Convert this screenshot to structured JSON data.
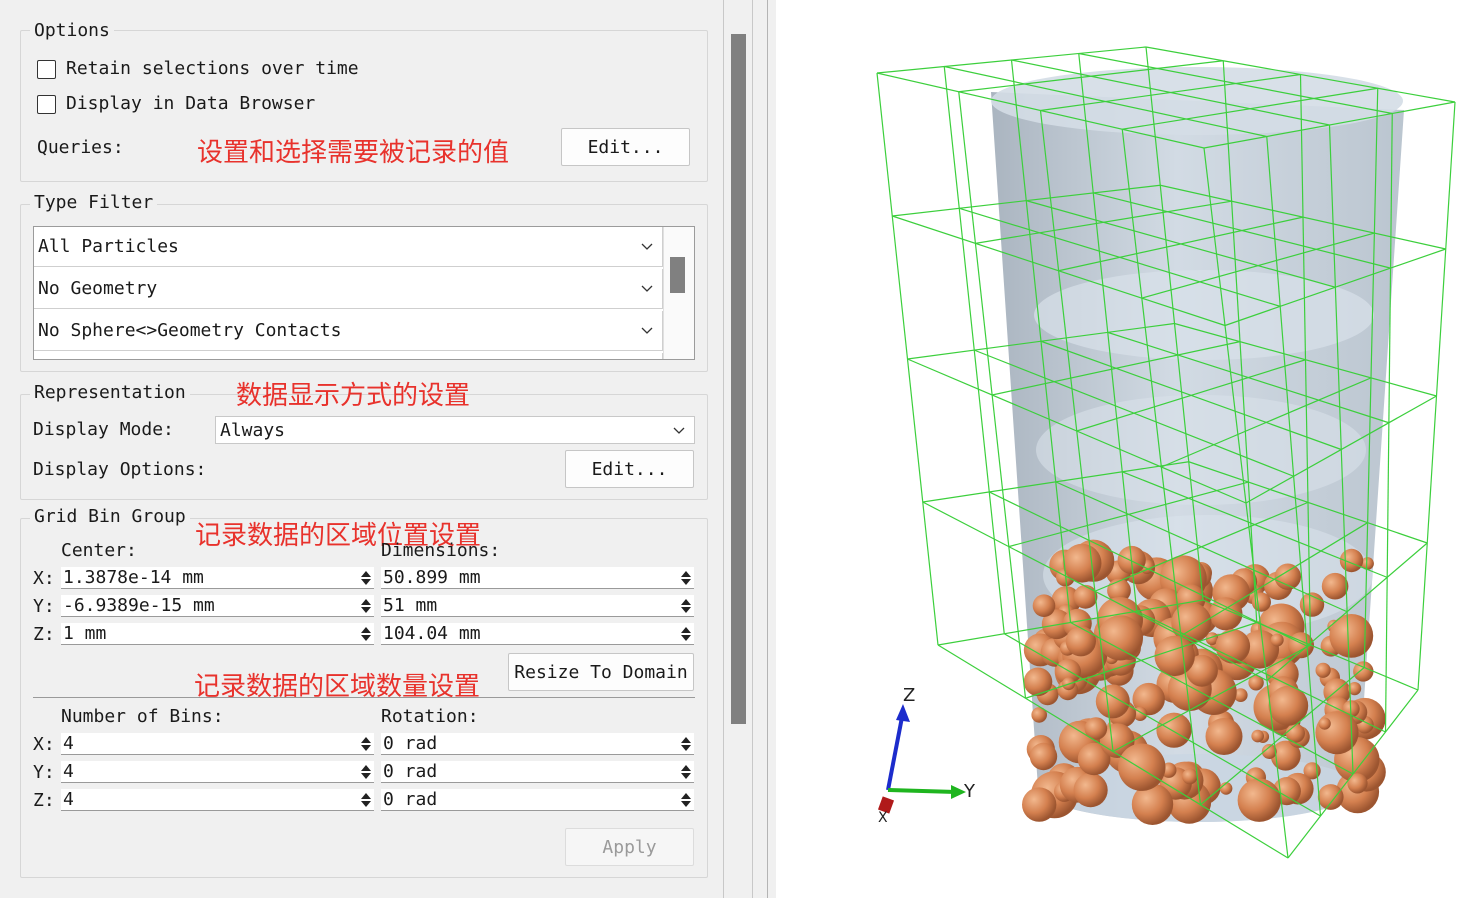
{
  "options": {
    "title": "Options",
    "retain_label": "Retain selections over time",
    "retain_checked": false,
    "display_browser_label": "Display in Data Browser",
    "display_browser_checked": false,
    "queries_label": "Queries:",
    "queries_edit": "Edit...",
    "annotation": "设置和选择需要被记录的值"
  },
  "type_filter": {
    "title": "Type Filter",
    "items": [
      "All Particles",
      "No Geometry",
      "No Sphere<>Geometry Contacts"
    ]
  },
  "representation": {
    "title": "Representation",
    "annotation": "数据显示方式的设置",
    "display_mode_label": "Display Mode:",
    "display_mode_value": "Always",
    "display_options_label": "Display Options:",
    "display_options_edit": "Edit..."
  },
  "grid_bin_group": {
    "title": "Grid Bin Group",
    "annotation_position": "记录数据的区域位置设置",
    "annotation_count": "记录数据的区域数量设置",
    "center_label": "Center:",
    "dimensions_label": "Dimensions:",
    "axes": [
      "X:",
      "Y:",
      "Z:"
    ],
    "center": [
      "1.3878e-14 mm",
      "-6.9389e-15 mm",
      "1 mm"
    ],
    "dimensions": [
      "50.899 mm",
      "51 mm",
      "104.04 mm"
    ],
    "resize_button": "Resize To Domain",
    "bins_label": "Number of Bins:",
    "rotation_label": "Rotation:",
    "bins": [
      "4",
      "4",
      "4"
    ],
    "rotation": [
      "0 rad",
      "0 rad",
      "0 rad"
    ],
    "apply_button": "Apply"
  },
  "viewport": {
    "axis_z": "Z",
    "axis_y": "Y",
    "axis_x": "X",
    "grid_color": "#3ccf3c",
    "particle_color": "#d98a5a",
    "cylinder_color": "#a8b8c8"
  }
}
